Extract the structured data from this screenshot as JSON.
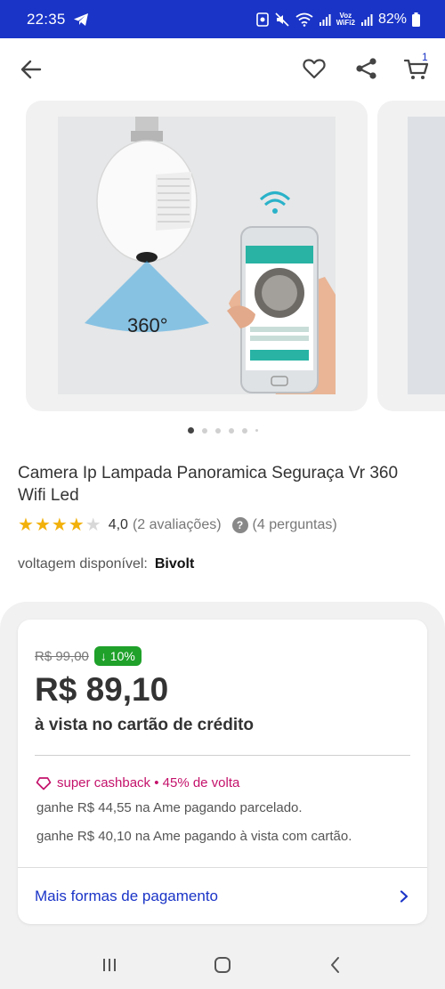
{
  "status_bar": {
    "time": "22:35",
    "network_label_top": "Voz",
    "network_label_bottom": "WiFi2",
    "battery": "82%",
    "colors": {
      "background": "#1a34c7"
    }
  },
  "header": {
    "cart_count": "1",
    "icons": [
      "back-arrow-icon",
      "heart-icon",
      "share-icon",
      "cart-icon"
    ]
  },
  "carousel": {
    "image_caption": "360°",
    "dot_count": 6,
    "active_index": 0
  },
  "product": {
    "title": "Camera Ip Lampada Panoramica Seguraça Vr 360 Wifi Led",
    "rating_value": "4,0",
    "rating_stars": 4,
    "rating_max": 5,
    "rating_count": "(2 avaliações)",
    "questions": "(4 perguntas)",
    "voltage_label": "voltagem disponível:",
    "voltage_value": "Bivolt"
  },
  "pricing": {
    "old_price": "R$ 99,00",
    "discount": "↓ 10%",
    "price": "R$ 89,10",
    "price_note": "à vista no cartão de crédito",
    "cashback_title": "super cashback • 45% de volta",
    "cashback_line1": "ganhe R$ 44,55 na Ame pagando parcelado.",
    "cashback_line2": "ganhe R$ 40,10 na Ame pagando à vista com cartão.",
    "more_payments": "Mais formas de pagamento",
    "colors": {
      "discount": "#1fa12a",
      "cashback": "#c4126b",
      "link": "#1a34c7"
    }
  },
  "nav_bar": {
    "icons": [
      "recent-apps-icon",
      "home-icon",
      "back-icon"
    ]
  }
}
